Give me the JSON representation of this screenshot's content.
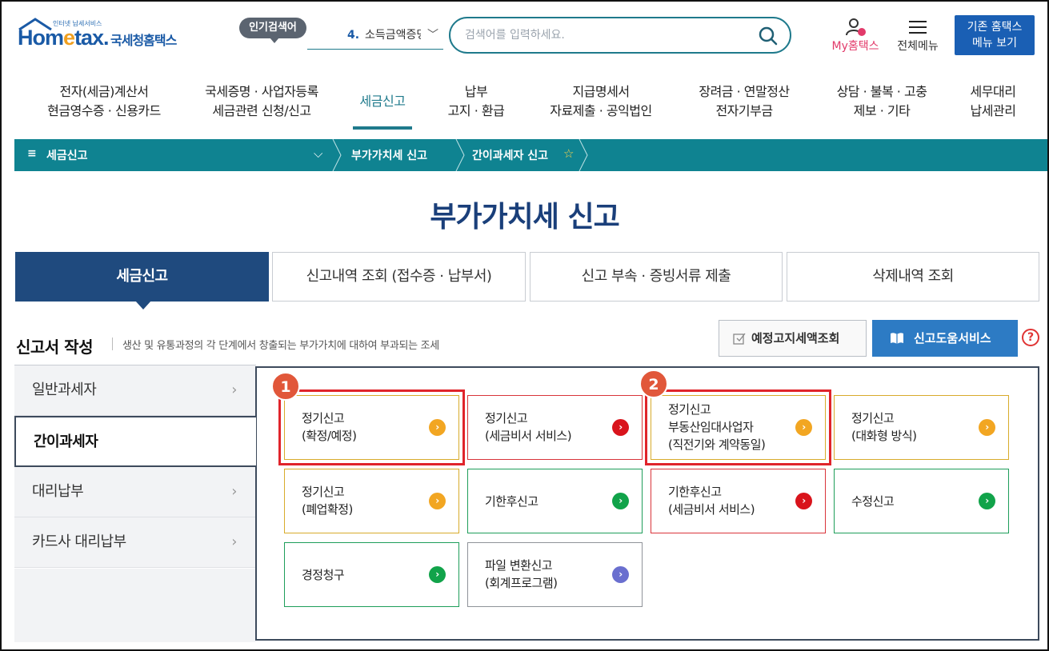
{
  "header": {
    "logo_small": "인터넷 납세서비스",
    "logo_brand_a": "Hom",
    "logo_brand_e": "e",
    "logo_brand_b": "tax.",
    "logo_korean": "국세청홈택스",
    "popular_badge": "인기검색어",
    "popular_rank": "4.",
    "popular_term": "소득금액증명",
    "search_placeholder": "검색어를 입력하세요.",
    "my_home": "My홈택스",
    "all_menu": "전체메뉴",
    "old_menu_line1": "기존 홈택스",
    "old_menu_line2": "메뉴 보기"
  },
  "gnb": [
    {
      "line1": "전자(세금)계산서",
      "line2": "현금영수증 · 신용카드"
    },
    {
      "line1": "국세증명 · 사업자등록",
      "line2": "세금관련 신청/신고"
    },
    {
      "line1": "세금신고",
      "line2": ""
    },
    {
      "line1": "납부",
      "line2": "고지 · 환급"
    },
    {
      "line1": "지급명세서",
      "line2": "자료제출 · 공익법인"
    },
    {
      "line1": "장려금 · 연말정산",
      "line2": "전자기부금"
    },
    {
      "line1": "상담 · 불복 · 고충",
      "line2": "제보 · 기타"
    },
    {
      "line1": "세무대리",
      "line2": "납세관리"
    }
  ],
  "breadcrumb": {
    "menu_icon": "≡",
    "level1": "세금신고",
    "level2": "부가가치세 신고",
    "level3": "간이과세자 신고"
  },
  "page_title": "부가가치세 신고",
  "tabs": [
    "세금신고",
    "신고내역 조회 (접수증 · 납부서)",
    "신고 부속 · 증빙서류 제출",
    "삭제내역 조회"
  ],
  "section": {
    "title": "신고서 작성",
    "description": "생산 및 유통과정의 각 단계에서 창출되는 부가가치에 대하여 부과되는 조세",
    "notice_button": "예정고지세액조회",
    "help_button": "신고도움서비스",
    "help_q": "?"
  },
  "left_menu": [
    {
      "label": "일반과세자",
      "active": false
    },
    {
      "label": "간이과세자",
      "active": true
    },
    {
      "label": "대리납부",
      "active": false
    },
    {
      "label": "카드사 대리납부",
      "active": false
    }
  ],
  "cards": [
    {
      "lines": [
        "정기신고",
        "(확정/예정)"
      ],
      "color": "yellow"
    },
    {
      "lines": [
        "정기신고",
        "(세금비서 서비스)"
      ],
      "color": "red"
    },
    {
      "lines": [
        "정기신고",
        "부동산임대사업자",
        "(직전기와 계약동일)"
      ],
      "color": "yellow"
    },
    {
      "lines": [
        "정기신고",
        "(대화형 방식)"
      ],
      "color": "yellow"
    },
    {
      "lines": [
        "정기신고",
        "(폐업확정)"
      ],
      "color": "yellow"
    },
    {
      "lines": [
        "기한후신고"
      ],
      "color": "green"
    },
    {
      "lines": [
        "기한후신고",
        "(세금비서 서비스)"
      ],
      "color": "red"
    },
    {
      "lines": [
        "수정신고"
      ],
      "color": "green"
    },
    {
      "lines": [
        "경정청구"
      ],
      "color": "green"
    },
    {
      "lines": [
        "파일 변환신고",
        "(회계프로그램)"
      ],
      "color": "purple"
    }
  ],
  "annotations": [
    "1",
    "2"
  ],
  "colors": {
    "teal": "#0f8391",
    "navy": "#1f4a7e",
    "title_navy": "#1a3f7a",
    "highlight_red": "#e0242b",
    "badge_orange": "#e1573a"
  }
}
